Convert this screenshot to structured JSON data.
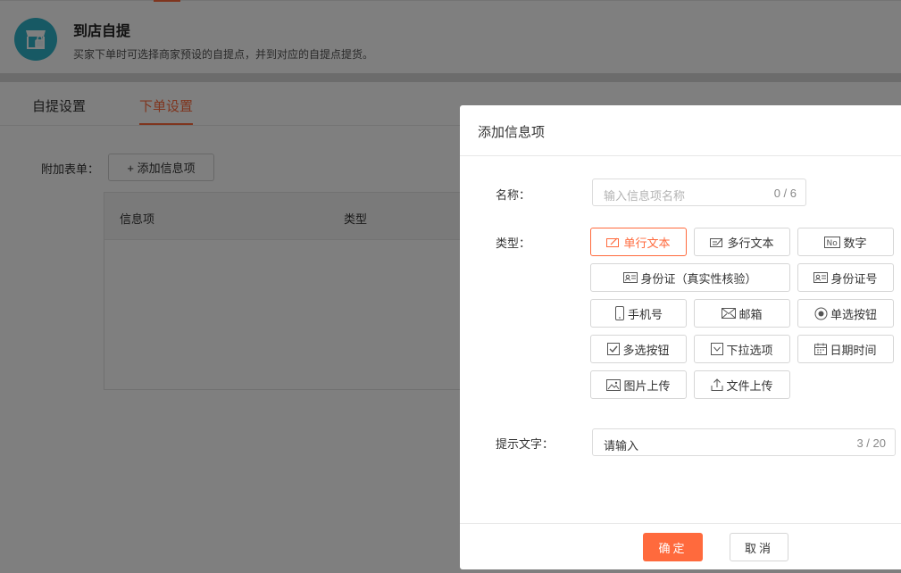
{
  "header": {
    "title": "到店自提",
    "description": "买家下单时可选择商家预设的自提点，并到对应的自提点提货。",
    "icon": "store-icon",
    "icon_color": "#2fb3c8"
  },
  "tabs": [
    {
      "label": "自提设置",
      "active": false
    },
    {
      "label": "下单设置",
      "active": true
    }
  ],
  "form": {
    "label": "附加表单：",
    "add_button": "+ 添加信息项",
    "table_headers": [
      "信息项",
      "类型"
    ]
  },
  "dialog": {
    "title": "添加信息项",
    "name_label": "名称：",
    "name_placeholder": "输入信息项名称",
    "name_counter": "0 / 6",
    "type_label": "类型：",
    "types": [
      {
        "label": "单行文本",
        "icon": "single-line-text-icon",
        "active": true
      },
      {
        "label": "多行文本",
        "icon": "multi-line-text-icon",
        "active": false
      },
      {
        "label": "数字",
        "icon": "number-icon",
        "active": false
      },
      {
        "label": "身份证（真实性核验）",
        "icon": "id-card-icon",
        "active": false
      },
      {
        "label": "身份证号",
        "icon": "id-card-icon",
        "active": false
      },
      {
        "label": "手机号",
        "icon": "phone-icon",
        "active": false
      },
      {
        "label": "邮箱",
        "icon": "mail-icon",
        "active": false
      },
      {
        "label": "单选按钮",
        "icon": "radio-icon",
        "active": false
      },
      {
        "label": "多选按钮",
        "icon": "checkbox-icon",
        "active": false
      },
      {
        "label": "下拉选项",
        "icon": "dropdown-icon",
        "active": false
      },
      {
        "label": "日期时间",
        "icon": "calendar-icon",
        "active": false
      },
      {
        "label": "图片上传",
        "icon": "image-icon",
        "active": false
      },
      {
        "label": "文件上传",
        "icon": "upload-icon",
        "active": false
      }
    ],
    "tip_label": "提示文字：",
    "tip_value": "请输入",
    "tip_counter": "3 / 20",
    "ok_button": "确定",
    "cancel_button": "取消"
  },
  "colors": {
    "accent": "#ff6a3d",
    "overlay": "rgba(0,0,0,0.5)"
  }
}
